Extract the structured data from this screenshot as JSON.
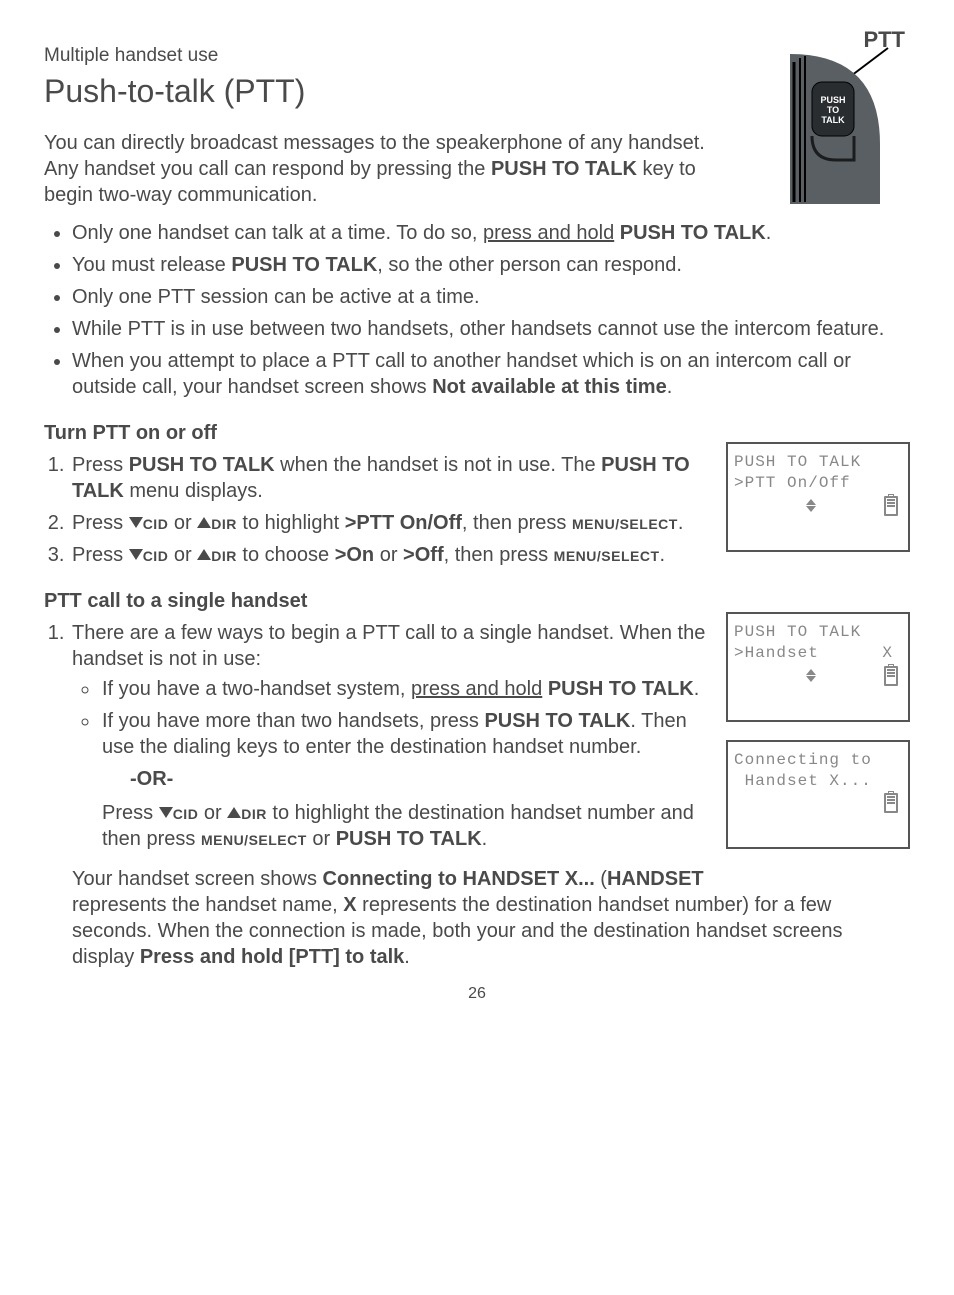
{
  "header": {
    "section": "Multiple handset use",
    "title": "Push-to-talk (PTT)"
  },
  "intro": {
    "t1": "You can directly broadcast messages to the speakerphone of any handset. Any handset you call can respond by pressing the ",
    "k1": "PUSH TO TALK",
    "t2": " key to begin two-way communication."
  },
  "bullets": {
    "b1a": "Only one handset can talk at a time. To do so, ",
    "b1u": "press and hold",
    "b1b": " ",
    "b1k": "PUSH TO TALK",
    "b1c": ".",
    "b2a": "You must release ",
    "b2k": "PUSH TO TALK",
    "b2b": ", so the other person can respond.",
    "b3": "Only one PTT session can be active at a time.",
    "b4": "While PTT is in use between two handsets, other handsets cannot use the intercom feature.",
    "b5a": "When you attempt to place a PTT call to another handset which is on an intercom call or outside call, your handset screen shows ",
    "b5k": "Not available at this time",
    "b5b": "."
  },
  "turn": {
    "head": "Turn PTT on or off",
    "s1a": "Press ",
    "s1k1": "PUSH TO TALK",
    "s1b": " when the handset is not in use. The ",
    "s1k2": "PUSH TO TALK",
    "s1c": " menu displays.",
    "s2a": "Press ",
    "cid": "CID",
    "s2b": " or ",
    "dir": "DIR",
    "s2c": " to highlight ",
    "s2k": ">PTT On/Off",
    "s2d": ", then press ",
    "menusel": "MENU/SELECT",
    "s2e": ".",
    "s3a": "Press ",
    "s3b": " or ",
    "s3c": " to choose ",
    "s3k1": ">On",
    "s3d": " or ",
    "s3k2": ">Off",
    "s3e": ", then press ",
    "s3f": "."
  },
  "single": {
    "head": "PTT call to a single handset",
    "s1": "There are a few ways to begin a PTT call to a single handset. When the handset is not in use:",
    "sub1a": "If you have a two-handset system, ",
    "sub1u": "press and hold",
    "sub1b": " ",
    "sub1k": "PUSH TO TALK",
    "sub1c": ".",
    "sub2a": "If you have more than two handsets, press ",
    "sub2k": "PUSH TO TALK",
    "sub2b": ". Then use the dialing keys to enter the destination handset number.",
    "or": "-OR-",
    "alt_a": "Press ",
    "alt_b": " or ",
    "alt_c": " to highlight the destination handset number and then press ",
    "alt_k1": "MENU/SELECT",
    "alt_d": " or ",
    "alt_k2": "PUSH TO TALK",
    "alt_e": ".",
    "result_a": "Your handset screen shows ",
    "result_k1": "Connecting to HANDSET X...",
    "result_b": " (",
    "result_k2": "HANDSET",
    "result_c": " represents the handset name, ",
    "result_k3": "X",
    "result_d": " represents the destination handset number) for a few seconds. When the connection is made, both your and the destination handset screens display ",
    "result_k4": "Press and hold [PTT] to talk",
    "result_e": "."
  },
  "device": {
    "ptt_label": "PTT",
    "btn_line1": "PUSH",
    "btn_line2": "TO",
    "btn_line3": "TALK"
  },
  "lcd1": {
    "l1": "PUSH TO TALK",
    "l2": ">PTT On/Off"
  },
  "lcd2": {
    "l1": "PUSH TO TALK",
    "l2": ">Handset      X"
  },
  "lcd3": {
    "l1": "Connecting to",
    "l2": " Handset X..."
  },
  "page": "26"
}
